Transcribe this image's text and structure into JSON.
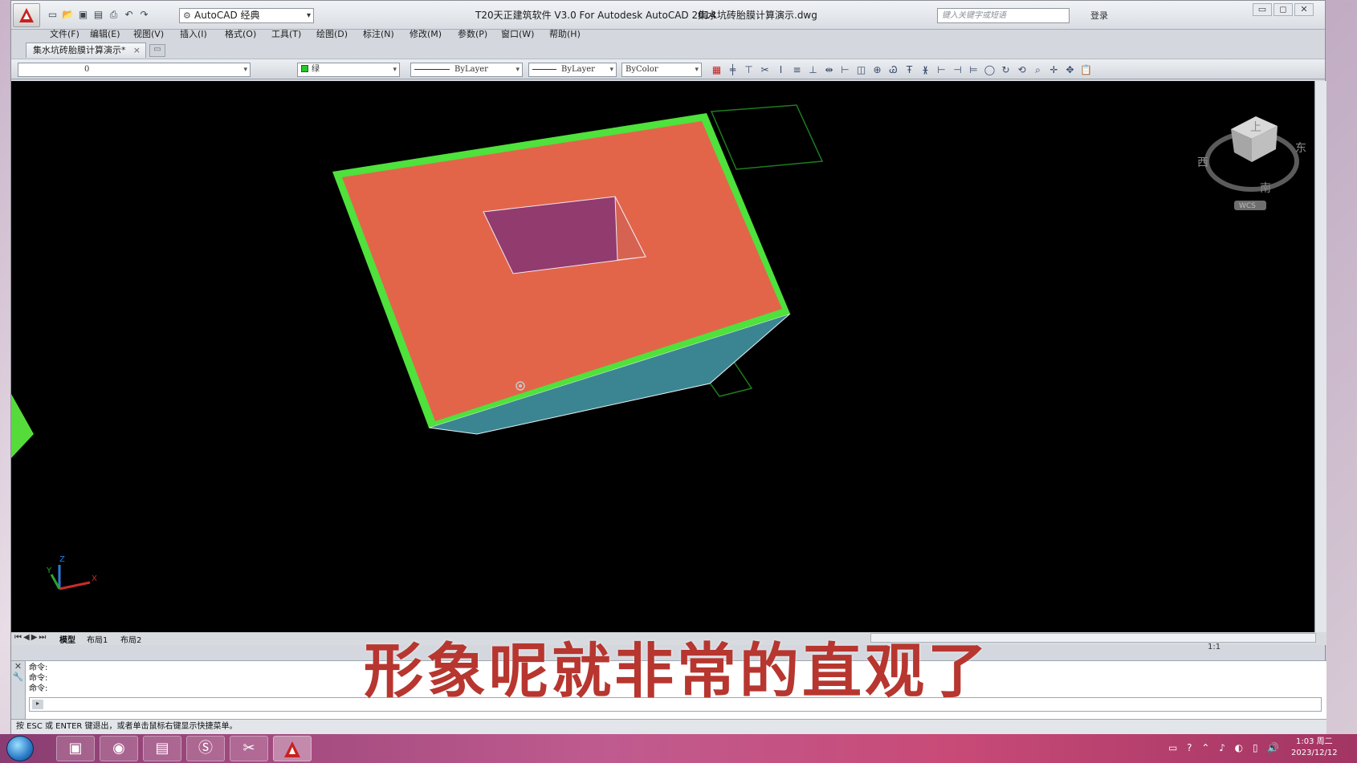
{
  "window": {
    "title": "T20天正建筑软件 V3.0 For Autodesk AutoCAD 2014",
    "filename": "集水坑砖胎膜计算演示.dwg",
    "workspace": "AutoCAD 经典",
    "search_placeholder": "键入关键字或短语",
    "login": "登录"
  },
  "menu": [
    "文件(F)",
    "编辑(E)",
    "视图(V)",
    "插入(I)",
    "格式(O)",
    "工具(T)",
    "绘图(D)",
    "标注(N)",
    "修改(M)",
    "参数(P)",
    "窗口(W)",
    "帮助(H)"
  ],
  "doc_tab": {
    "label": "集水坑砖胎膜计算演示*"
  },
  "properties": {
    "layer": "0",
    "color": "绿",
    "linetype": "ByLayer",
    "lineweight": "ByLayer",
    "plotstyle": "ByColor",
    "accent_color": "#29c628"
  },
  "viewcube": {
    "top": "上",
    "west": "西",
    "east": "东",
    "south": "南",
    "wcs": "WCS"
  },
  "ucs": {
    "x": "X",
    "y": "Y",
    "z": "Z"
  },
  "layout_tabs": [
    "模型",
    "布局1",
    "布局2"
  ],
  "annotation_scale": "1:1",
  "command_history": [
    "命令:",
    "命令:",
    "命令:"
  ],
  "status_text": "按 ESC 或 ENTER 键退出，或者单击鼠标右键显示快捷菜单。",
  "subtitle": "形象呢就非常的直观了",
  "colors": {
    "top_face": "#e2654a",
    "side_face": "#3b8592",
    "hole_face": "#923b6f",
    "edge": "#4fe13c"
  },
  "taskbar": {
    "time": "1:03 周二",
    "date": "2023/12/12"
  }
}
